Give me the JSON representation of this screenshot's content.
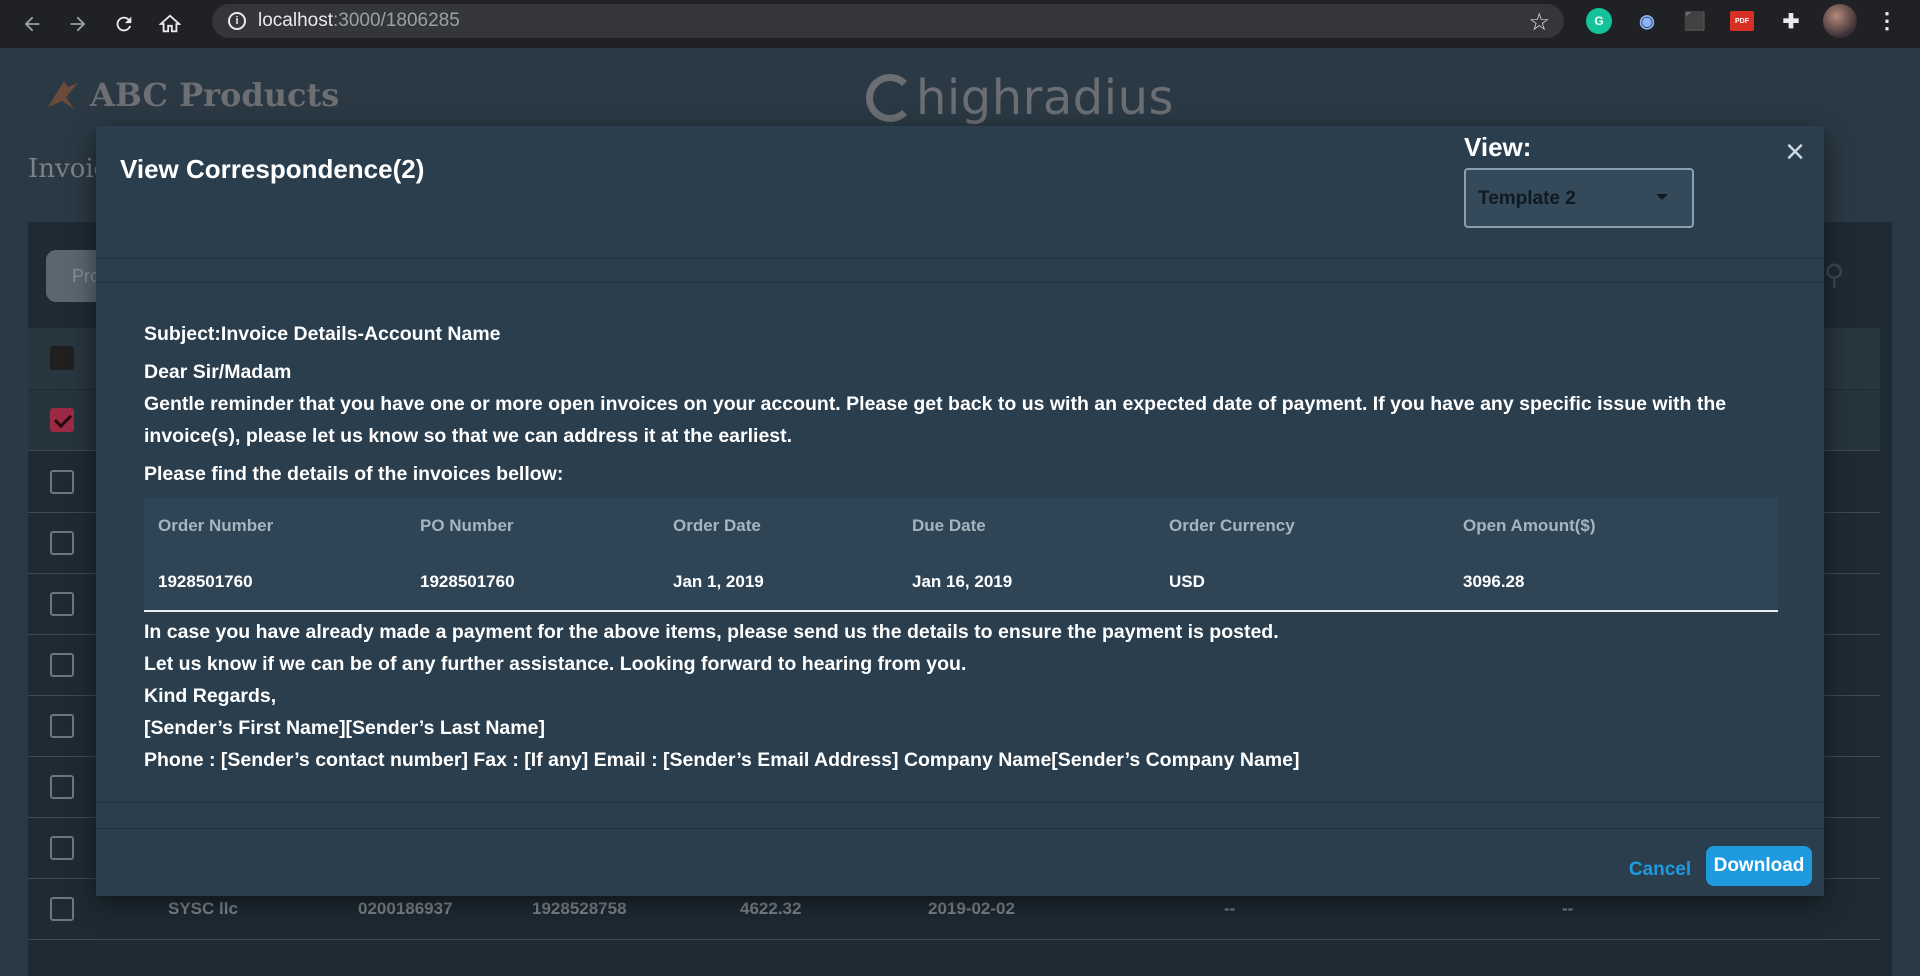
{
  "browser": {
    "url_host": "localhost",
    "url_path": ":3000/1806285",
    "icons": [
      "back-icon",
      "forward-icon",
      "reload-icon",
      "home-icon",
      "info-icon",
      "star-icon",
      "grammarly-icon",
      "eye-extension-icon",
      "camera-icon",
      "pdf-icon",
      "puzzle-icon",
      "profile-avatar",
      "kebab-menu-icon"
    ],
    "ext_g_label": "G",
    "ext_pdf_label": "PDF"
  },
  "app": {
    "brand": "ABC Products",
    "hr_brand": "highradius",
    "page_title": "Invoic",
    "search_placeholder": "Pro",
    "last_row": {
      "customer": "SYSC llc",
      "customer_no": "0200186937",
      "invoice_id": "1928528758",
      "amount": "4622.32",
      "due_date": "2019-02-02",
      "col6": "--",
      "col7": "--"
    }
  },
  "modal": {
    "title": "View Correspondence(2)",
    "view_label": "View:",
    "view_selected": "Template 2",
    "subject": "Subject:Invoice Details-Account Name",
    "greeting": "Dear Sir/Madam",
    "reminder": "Gentle reminder that you have one or more open invoices on your account. Please get back to us with an expected date of payment. If you have any specific issue with the invoice(s), please let us know so that we can address it at the earliest.",
    "details_intro": "Please find the details of the invoices bellow:",
    "table": {
      "headers": [
        "Order Number",
        "PO Number",
        "Order Date",
        "Due Date",
        "Order Currency",
        "Open Amount($)"
      ],
      "rows": [
        [
          "1928501760",
          "1928501760",
          "Jan 1, 2019",
          "Jan 16, 2019",
          "USD",
          "3096.28"
        ]
      ]
    },
    "closing_1": "In case you have already made a payment for the above items, please send us the details to ensure the payment is posted.",
    "closing_2": "Let us know if we can be of any further assistance. Looking forward to hearing from you.",
    "regards": "Kind Regards,",
    "sender_name": "[Sender’s First Name][Sender’s Last Name]",
    "contact_line": "Phone : [Sender’s contact number] Fax : [If any] Email : [Sender’s Email Address] Company Name[Sender’s Company Name]",
    "cancel_label": "Cancel",
    "download_label": "Download"
  }
}
